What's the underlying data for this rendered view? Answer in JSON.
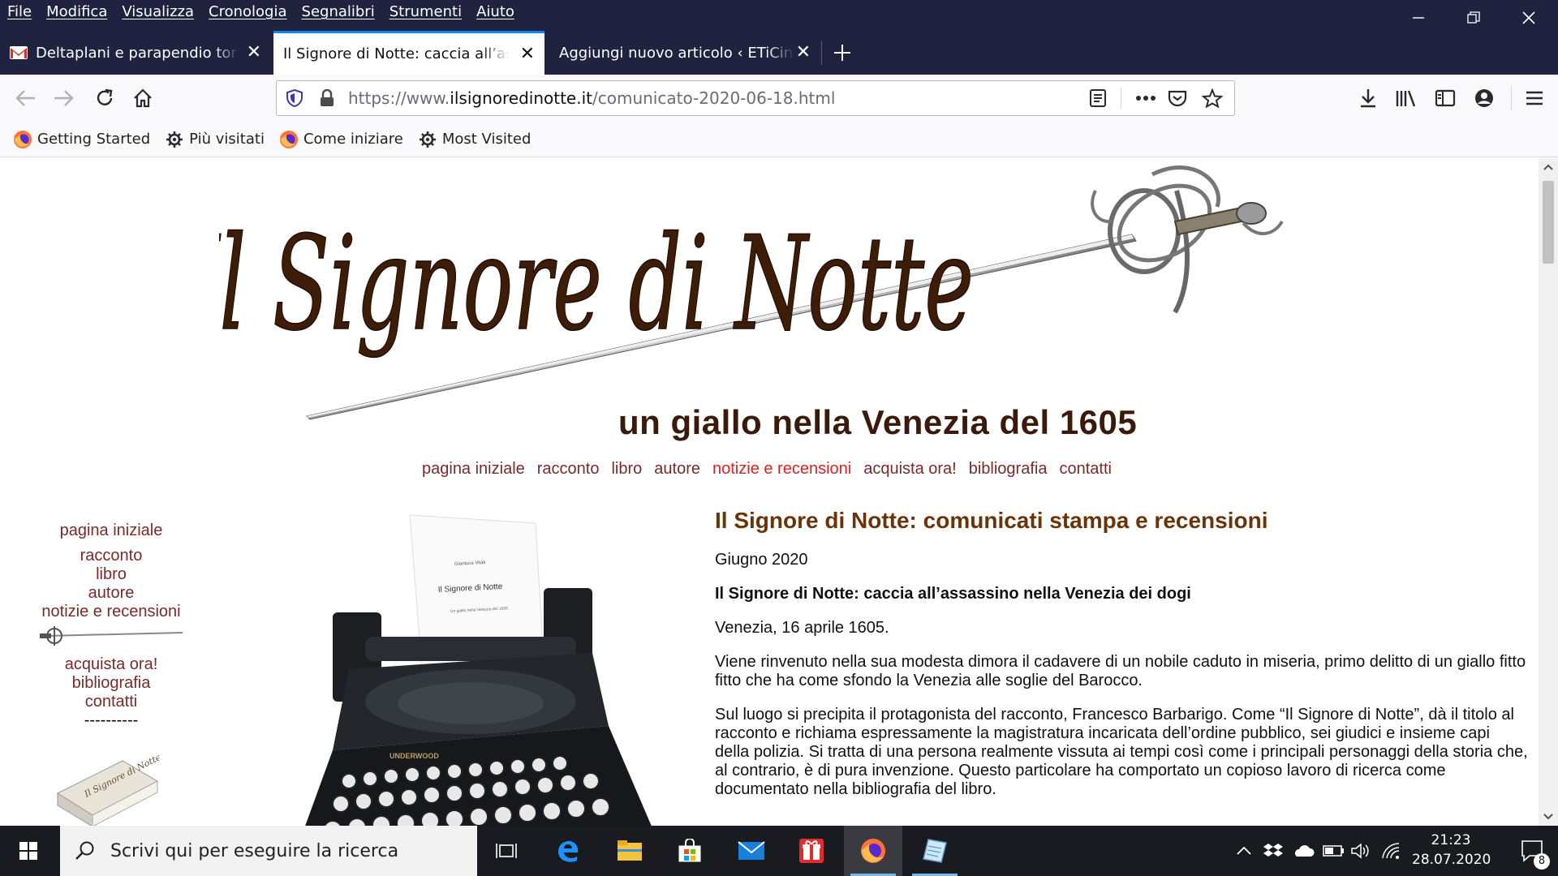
{
  "menubar": {
    "items": [
      "File",
      "Modifica",
      "Visualizza",
      "Cronologia",
      "Segnalibri",
      "Strumenti",
      "Aiuto"
    ]
  },
  "tabs": [
    {
      "title": "Deltaplani e parapendio tornano",
      "active": false,
      "icon": "gmail-icon"
    },
    {
      "title": "Il Signore di Notte: caccia all’assassino",
      "active": true,
      "icon": ""
    },
    {
      "title": "Aggiungi nuovo articolo ‹ ETiCinform",
      "active": false,
      "icon": ""
    }
  ],
  "url": {
    "prefix": "https://www.",
    "domain": "ilsignoredinotte.it",
    "path": "/comunicato-2020-06-18.html"
  },
  "bookmarks": [
    {
      "label": "Getting Started",
      "icon": "firefox-icon"
    },
    {
      "label": "Più visitati",
      "icon": "gear-icon"
    },
    {
      "label": "Come iniziare",
      "icon": "firefox-icon"
    },
    {
      "label": "Most Visited",
      "icon": "gear-icon"
    }
  ],
  "site": {
    "logo_text": "Il Signore di Notte",
    "subtitle": "un giallo nella Venezia del 1605",
    "typewriter_page": {
      "author": "Gianluca Vitali",
      "title": "Il Signore di Notte",
      "subtitle": "Un giallo nella Venezia del 1605"
    },
    "book_cover_title": "Il Signore di Notte",
    "top_nav": [
      "pagina iniziale",
      "racconto",
      "libro",
      "autore",
      "notizie e recensioni",
      "acquista ora!",
      "bibliografia",
      "contatti"
    ],
    "top_nav_current": "notizie e recensioni",
    "side_nav_top": [
      "pagina iniziale",
      "racconto",
      "libro",
      "autore",
      "notizie e recensioni"
    ],
    "side_nav_bottom": [
      "acquista ora!",
      "bibliografia",
      "contatti"
    ],
    "side_divider": "----------",
    "colors": {
      "nav_link": "#7a2a2a",
      "nav_current": "#e02020",
      "heading": "#6a3408"
    }
  },
  "article": {
    "heading": "Il Signore di Notte: comunicati stampa e recensioni",
    "date": "Giugno 2020",
    "lead": "Il Signore di Notte: caccia all’assassino nella Venezia dei dogi",
    "dateline": "Venezia, 16 aprile 1605.",
    "p1": "Viene rinvenuto nella sua modesta dimora il cadavere di un nobile caduto in miseria, primo delitto di un giallo fitto fitto che ha come sfondo la Venezia alle soglie del Barocco.",
    "p2": "Sul luogo si precipita il protagonista del racconto, Francesco Barbarigo. Come “Il Signore di Notte”, dà il titolo al racconto e richiama espressamente la magistratura incaricata dell’ordine pubblico, sei giudici e insieme capi della polizia. Si tratta di una persona realmente vissuta ai tempi così come i principali personaggi della storia che, al contrario, è di pura invenzione. Questo particolare ha comportato un copioso lavoro di ricerca come documentato nella bibliografia del libro."
  },
  "taskbar": {
    "search_placeholder": "Scrivi qui per eseguire la ricerca",
    "apps": [
      "task-view-icon",
      "edge-icon",
      "file-explorer-icon",
      "store-icon",
      "mail-icon",
      "gift-icon",
      "firefox-icon",
      "notepad-icon"
    ],
    "time": "21:23",
    "date": "28.07.2020",
    "notifications": "8"
  }
}
